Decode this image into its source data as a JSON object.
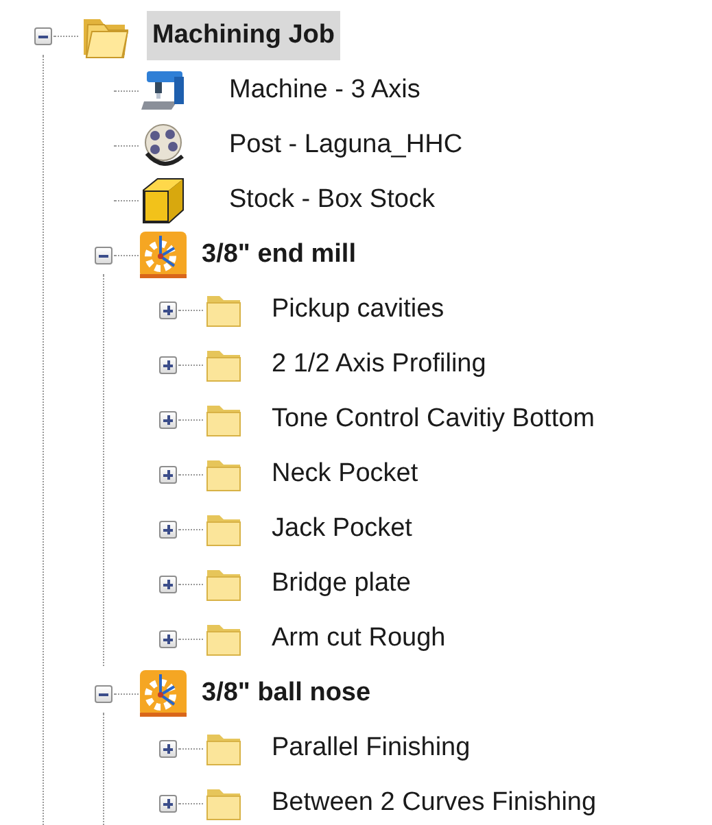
{
  "tree": [
    {
      "label": "Machining Job",
      "kind": "job",
      "expanded": true,
      "selected": true,
      "children": [
        {
          "label": "Machine - 3 Axis",
          "kind": "machine",
          "selected": false
        },
        {
          "label": "Post - Laguna_HHC",
          "kind": "post",
          "selected": false
        },
        {
          "label": "Stock - Box Stock",
          "kind": "stock",
          "selected": false
        },
        {
          "label": "3/8\" end mill",
          "kind": "tool",
          "expanded": true,
          "selected": false,
          "children": [
            {
              "label": "Pickup cavities",
              "kind": "folder",
              "expanded": false,
              "selected": false
            },
            {
              "label": "2 1/2 Axis Profiling",
              "kind": "folder",
              "expanded": false,
              "selected": false
            },
            {
              "label": "Tone Control Cavitiy Bottom",
              "kind": "folder",
              "expanded": false,
              "selected": false
            },
            {
              "label": "Neck Pocket",
              "kind": "folder",
              "expanded": false,
              "selected": false
            },
            {
              "label": "Jack Pocket",
              "kind": "folder",
              "expanded": false,
              "selected": false
            },
            {
              "label": "Bridge plate",
              "kind": "folder",
              "expanded": false,
              "selected": false
            },
            {
              "label": "Arm cut Rough",
              "kind": "folder",
              "expanded": false,
              "selected": false
            }
          ]
        },
        {
          "label": "3/8\" ball nose",
          "kind": "tool",
          "expanded": true,
          "selected": false,
          "children": [
            {
              "label": "Parallel Finishing",
              "kind": "folder",
              "expanded": false,
              "selected": false
            },
            {
              "label": "Between 2 Curves Finishing",
              "kind": "folder",
              "expanded": false,
              "selected": false
            }
          ]
        }
      ]
    }
  ]
}
